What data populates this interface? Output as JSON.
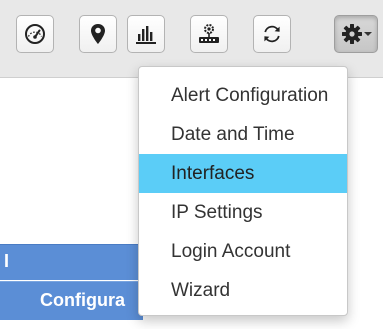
{
  "toolbar": {
    "buttons": [
      {
        "icon": "dashboard-gauge-icon"
      },
      {
        "icon": "location-pin-icon"
      },
      {
        "icon": "bar-chart-icon"
      },
      {
        "icon": "network-device-icon"
      },
      {
        "icon": "refresh-icon"
      },
      {
        "icon": "gear-icon",
        "has_dropdown": true
      }
    ]
  },
  "background": {
    "bar1_text": "I",
    "bar2_text": "Configura"
  },
  "settings_menu": {
    "items": [
      {
        "label": "Alert Configuration"
      },
      {
        "label": "Date and Time"
      },
      {
        "label": "Interfaces"
      },
      {
        "label": "IP Settings"
      },
      {
        "label": "Login Account"
      },
      {
        "label": "Wizard"
      }
    ],
    "highlighted_item": "Interfaces"
  },
  "colors": {
    "menu_highlight": "#5bcdf7",
    "header_blue": "#5b8ed6"
  }
}
